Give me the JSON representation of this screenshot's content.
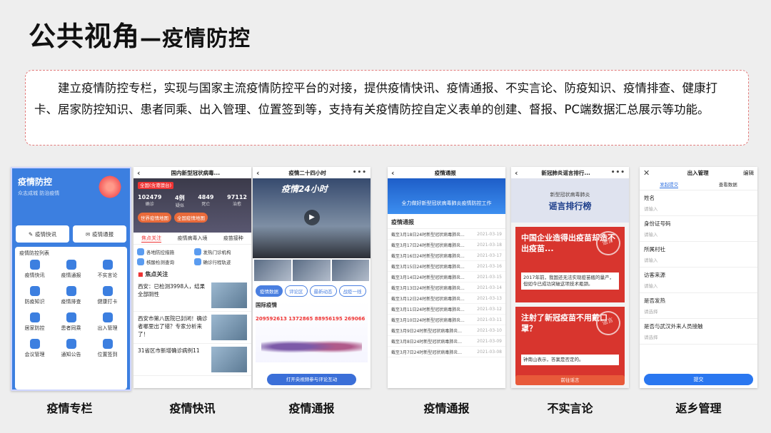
{
  "title": {
    "main": "公共视角",
    "dash": "—",
    "sub": "疫情防控"
  },
  "description": "建立疫情防控专栏，实现与国家主流疫情防控平台的对接，提供疫情快讯、疫情通报、不实言论、防疫知识、疫情排查、健康打卡、居家防控知识、患者同乘、出入管理、位置签到等，支持有关疫情防控自定义表单的创建、督报、PC端数据汇总展示等功能。",
  "captions": [
    "疫情专栏",
    "疫情快讯",
    "疫情通报",
    "疫情通报",
    "不实言论",
    "返乡管理"
  ],
  "phone1": {
    "title": "疫情防控",
    "subtitle": "众志成城 防治疫情",
    "pills": [
      "疫情快讯",
      "疫情通报"
    ],
    "grid_title": "疫情防控列表",
    "items": [
      "疫情快讯",
      "疫情通报",
      "不实言论",
      "防疫知识",
      "疫情排查",
      "健康打卡",
      "居家防控",
      "患者同乘",
      "出入管理",
      "会议管理",
      "通知公告",
      "位置签到"
    ]
  },
  "phone2": {
    "nav": "国内新型冠状病毒...",
    "tag": "全国(含港澳台)",
    "stats": [
      {
        "n": "102479",
        "l": "确诊"
      },
      {
        "n": "4例",
        "l": "疑似"
      },
      {
        "n": "4849",
        "l": "死亡"
      },
      {
        "n": "97112",
        "l": "治愈"
      }
    ],
    "tags": [
      "世界疫情地图",
      "全国疫情地图"
    ],
    "tabs": [
      "焦点关注",
      "疫情病毒入境",
      "疫苗接种"
    ],
    "entries": [
      "各地防控措施",
      "发热门诊机构",
      "核酸检测查询",
      "确诊行程轨迹"
    ],
    "section": "焦点关注",
    "news": [
      "西安：已检测3998人，结果全部阴性",
      "西安市第八医院已封闭！确诊者哪里出了错？专家分析来了！",
      "31省区市新增确诊病例11"
    ]
  },
  "phone3": {
    "nav": "疫情二十四小时",
    "logo": "疫情24小时",
    "chips": [
      "疫情数据",
      "评论区",
      "最新动态",
      "战疫一线"
    ],
    "map_title": "国际疫情",
    "big_number": "209592613 1372865 88956195 269066",
    "cta": "打开央视频参与评论互动"
  },
  "phone4": {
    "nav": "疫情通报",
    "banner": "全力做好新型冠状病毒肺炎疫情防控工作",
    "section": "疫情通报",
    "items": [
      {
        "t": "截至3月18日24时新型冠状病毒肺炎...",
        "d": "2021-03-19"
      },
      {
        "t": "截至3月17日24时新型冠状病毒肺炎...",
        "d": "2021-03-18"
      },
      {
        "t": "截至3月16日24时新型冠状病毒肺炎...",
        "d": "2021-03-17"
      },
      {
        "t": "截至3月15日24时新型冠状病毒肺炎...",
        "d": "2021-03-16"
      },
      {
        "t": "截至3月14日24时新型冠状病毒肺炎...",
        "d": "2021-03-15"
      },
      {
        "t": "截至3月13日24时新型冠状病毒肺炎...",
        "d": "2021-03-14"
      },
      {
        "t": "截至3月12日24时新型冠状病毒肺炎...",
        "d": "2021-03-13"
      },
      {
        "t": "截至3月11日24时新型冠状病毒肺炎...",
        "d": "2021-03-12"
      },
      {
        "t": "截至3月10日24时新型冠状病毒肺炎...",
        "d": "2021-03-11"
      },
      {
        "t": "截至3月9日24时新型冠状病毒肺炎...",
        "d": "2021-03-10"
      },
      {
        "t": "截至3月8日24时新型冠状病毒肺炎...",
        "d": "2021-03-09"
      },
      {
        "t": "截至3月7日24时新型冠状病毒肺炎...",
        "d": "2021-03-08"
      }
    ]
  },
  "phone5": {
    "nav": "新冠肺炎谣言排行...",
    "header_a": "新型冠状病毒肺炎",
    "header_b": "谣言排行榜",
    "cards": [
      {
        "q": "中国企业造得出疫苗却造不出疫苗...",
        "p": "2017年前，我国还无法实现疫苗瓶的量产，但如今已成功突破这项技术瓶颈。",
        "stamp": "谣言"
      },
      {
        "q": "注射了新冠疫苗不用戴口罩？",
        "p": "钟南山表示，答案是否定的。",
        "stamp": "谣言"
      }
    ],
    "button": "前往谣言"
  },
  "phone6": {
    "nav": "出入管理",
    "nav_right": "编辑",
    "tabs": [
      "发起提交",
      "查看数据"
    ],
    "fields": [
      {
        "k": "姓名",
        "v": "请输入"
      },
      {
        "k": "身份证号码",
        "v": "请输入"
      },
      {
        "k": "所属村社",
        "v": "请输入"
      },
      {
        "k": "访客来源",
        "v": "请输入"
      },
      {
        "k": "是否发热",
        "v": "请选择"
      },
      {
        "k": "是否与武汉外来人员接触",
        "v": "请选择"
      }
    ],
    "submit": "提交"
  }
}
